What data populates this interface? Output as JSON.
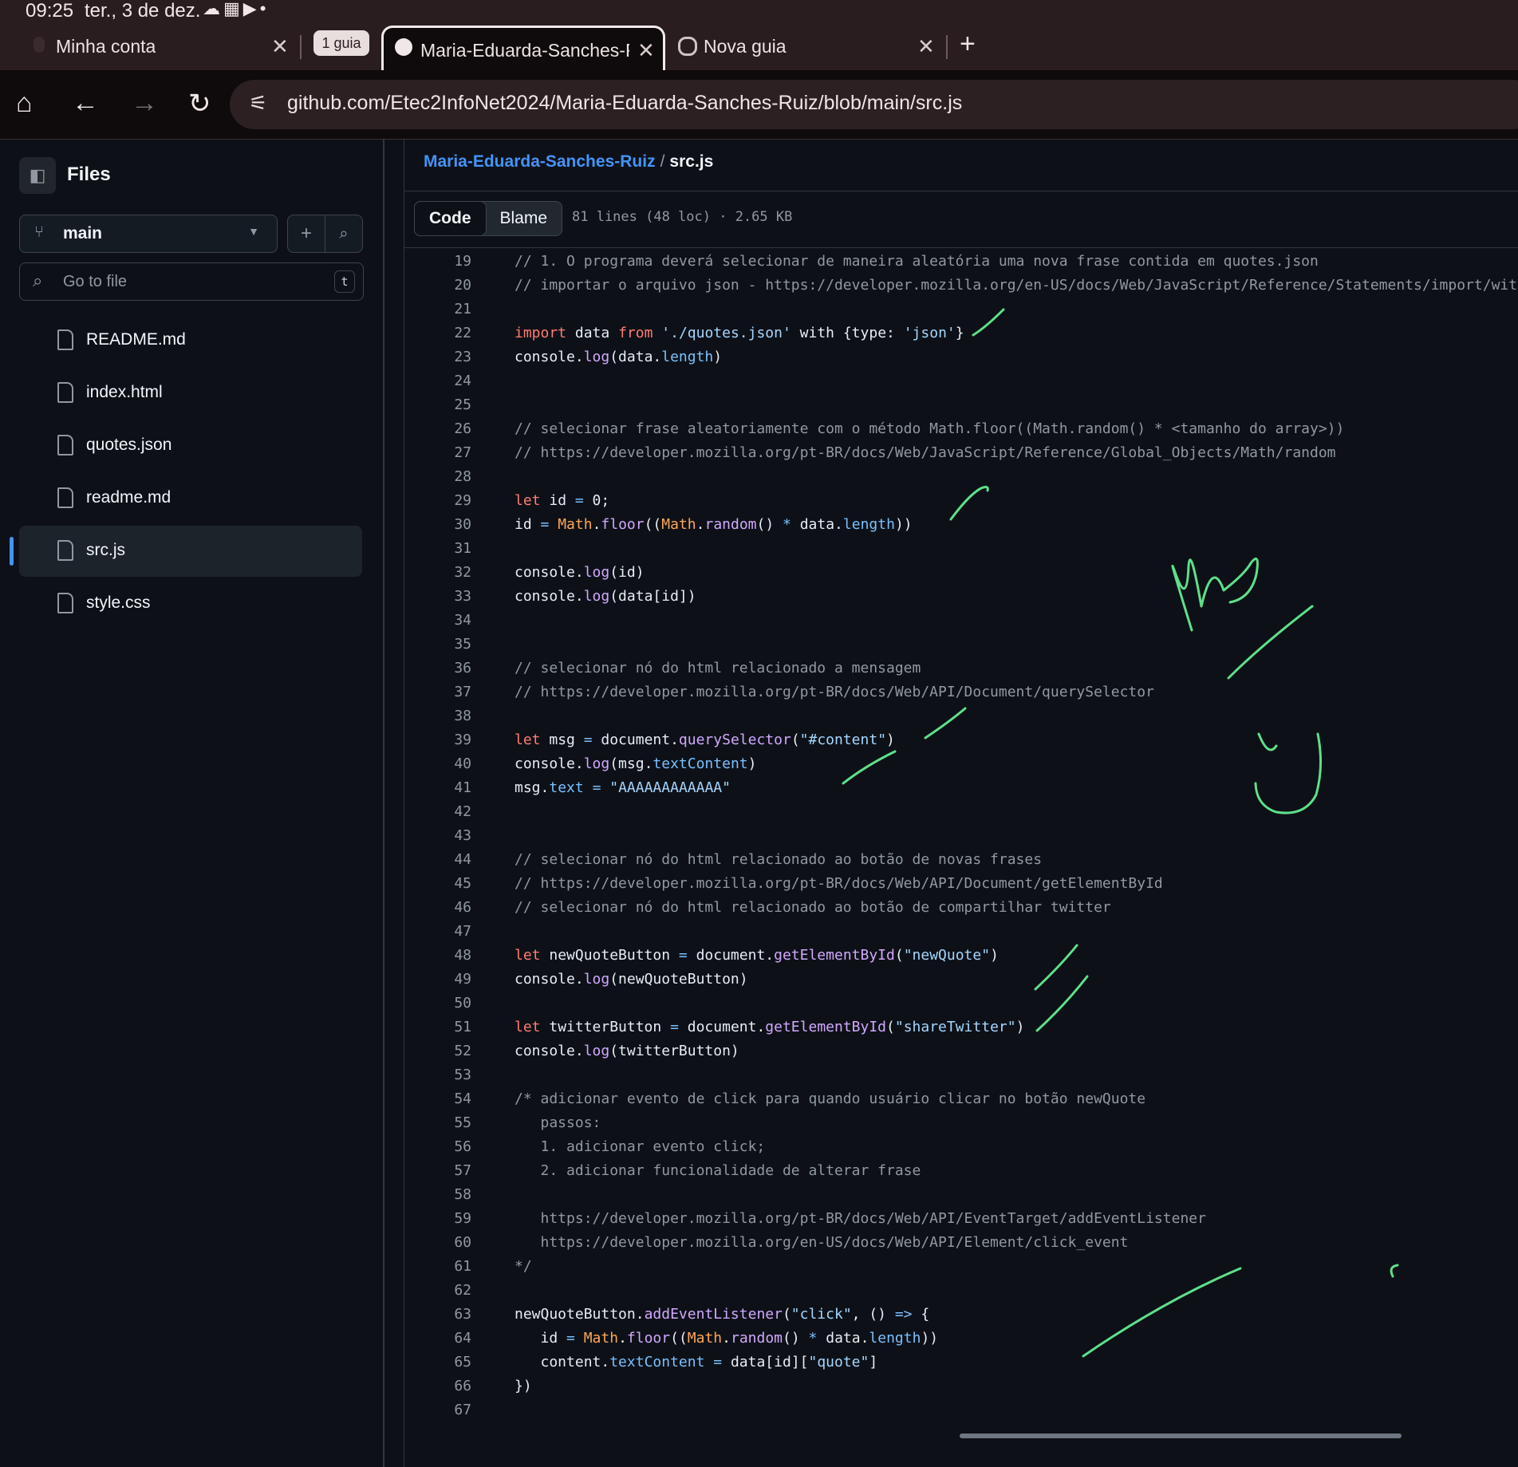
{
  "status_bar": {
    "time": "09:25",
    "date": "ter., 3 de dez.",
    "icons": [
      "cloud-icon",
      "calendar-icon",
      "youtube-icon",
      "dot-icon"
    ]
  },
  "tabs": [
    {
      "title": "Minha conta",
      "close": "✕"
    },
    {
      "title": "Maria-Eduarda-Sanches-R",
      "close": "✕",
      "active": true
    },
    {
      "title": "Nova guia",
      "close": "✕"
    }
  ],
  "tab_group_label": "1 guia",
  "toolbar": {
    "url": "github.com/Etec2InfoNet2024/Maria-Eduarda-Sanches-Ruiz/blob/main/src.js"
  },
  "sidebar": {
    "title": "Files",
    "branch": "main",
    "goto_placeholder": "Go to file",
    "goto_shortcut": "t",
    "files": [
      {
        "name": "README.md",
        "active": false
      },
      {
        "name": "index.html",
        "active": false
      },
      {
        "name": "quotes.json",
        "active": false
      },
      {
        "name": "readme.md",
        "active": false
      },
      {
        "name": "src.js",
        "active": true
      },
      {
        "name": "style.css",
        "active": false
      }
    ]
  },
  "breadcrumb": {
    "repo": "Maria-Eduarda-Sanches-Ruiz",
    "separator": "/",
    "file": "src.js"
  },
  "file_header": {
    "code_tab": "Code",
    "blame_tab": "Blame",
    "meta": "81 lines (48 loc) · 2.65 KB"
  },
  "code": {
    "lines": [
      {
        "n": "19",
        "t": "// 1. O programa deverá selecionar de maneira aleatória uma nova frase contida em quotes.json"
      },
      {
        "n": "20",
        "t": "// importar o arquivo json - https://developer.mozilla.org/en-US/docs/Web/JavaScript/Reference/Statements/import/with"
      },
      {
        "n": "21",
        "t": ""
      },
      {
        "n": "22",
        "t": "import data from './quotes.json' with {type: 'json'}"
      },
      {
        "n": "23",
        "t": "console.log(data.length)"
      },
      {
        "n": "24",
        "t": ""
      },
      {
        "n": "25",
        "t": ""
      },
      {
        "n": "26",
        "t": "// selecionar frase aleatoriamente com o método Math.floor((Math.random() * <tamanho do array>))"
      },
      {
        "n": "27",
        "t": "// https://developer.mozilla.org/pt-BR/docs/Web/JavaScript/Reference/Global_Objects/Math/random"
      },
      {
        "n": "28",
        "t": ""
      },
      {
        "n": "29",
        "t": "let id = 0;"
      },
      {
        "n": "30",
        "t": "id = Math.floor((Math.random() * data.length))"
      },
      {
        "n": "31",
        "t": ""
      },
      {
        "n": "32",
        "t": "console.log(id)"
      },
      {
        "n": "33",
        "t": "console.log(data[id])"
      },
      {
        "n": "34",
        "t": ""
      },
      {
        "n": "35",
        "t": ""
      },
      {
        "n": "36",
        "t": "// selecionar nó do html relacionado a mensagem"
      },
      {
        "n": "37",
        "t": "// https://developer.mozilla.org/pt-BR/docs/Web/API/Document/querySelector"
      },
      {
        "n": "38",
        "t": ""
      },
      {
        "n": "39",
        "t": "let msg = document.querySelector(\"#content\")"
      },
      {
        "n": "40",
        "t": "console.log(msg.textContent)"
      },
      {
        "n": "41",
        "t": "msg.text = \"AAAAAAAAAAAA\""
      },
      {
        "n": "42",
        "t": ""
      },
      {
        "n": "43",
        "t": ""
      },
      {
        "n": "44",
        "t": "// selecionar nó do html relacionado ao botão de novas frases"
      },
      {
        "n": "45",
        "t": "// https://developer.mozilla.org/pt-BR/docs/Web/API/Document/getElementById"
      },
      {
        "n": "46",
        "t": "// selecionar nó do html relacionado ao botão de compartilhar twitter"
      },
      {
        "n": "47",
        "t": ""
      },
      {
        "n": "48",
        "t": "let newQuoteButton = document.getElementById(\"newQuote\")"
      },
      {
        "n": "49",
        "t": "console.log(newQuoteButton)"
      },
      {
        "n": "50",
        "t": ""
      },
      {
        "n": "51",
        "t": "let twitterButton = document.getElementById(\"shareTwitter\")"
      },
      {
        "n": "52",
        "t": "console.log(twitterButton)"
      },
      {
        "n": "53",
        "t": ""
      },
      {
        "n": "54",
        "t": "/* adicionar evento de click para quando usuário clicar no botão newQuote"
      },
      {
        "n": "55",
        "t": "   passos:"
      },
      {
        "n": "56",
        "t": "   1. adicionar evento click;"
      },
      {
        "n": "57",
        "t": "   2. adicionar funcionalidade de alterar frase"
      },
      {
        "n": "58",
        "t": ""
      },
      {
        "n": "59",
        "t": "   https://developer.mozilla.org/pt-BR/docs/Web/API/EventTarget/addEventListener"
      },
      {
        "n": "60",
        "t": "   https://developer.mozilla.org/en-US/docs/Web/API/Element/click_event"
      },
      {
        "n": "61",
        "t": "*/"
      },
      {
        "n": "62",
        "t": ""
      },
      {
        "n": "63",
        "t": "newQuoteButton.addEventListener(\"click\", () => {"
      },
      {
        "n": "64",
        "t": "   id = Math.floor((Math.random() * data.length))"
      },
      {
        "n": "65",
        "t": "   content.textContent = data[id][\"quote\"]"
      },
      {
        "n": "66",
        "t": "})"
      },
      {
        "n": "67",
        "t": ""
      }
    ]
  },
  "colors": {
    "accent": "#4493f8",
    "ink": "#5ee08a",
    "keyword": "#ff7b72",
    "string": "#a5d6ff",
    "function": "#d2a8ff"
  }
}
